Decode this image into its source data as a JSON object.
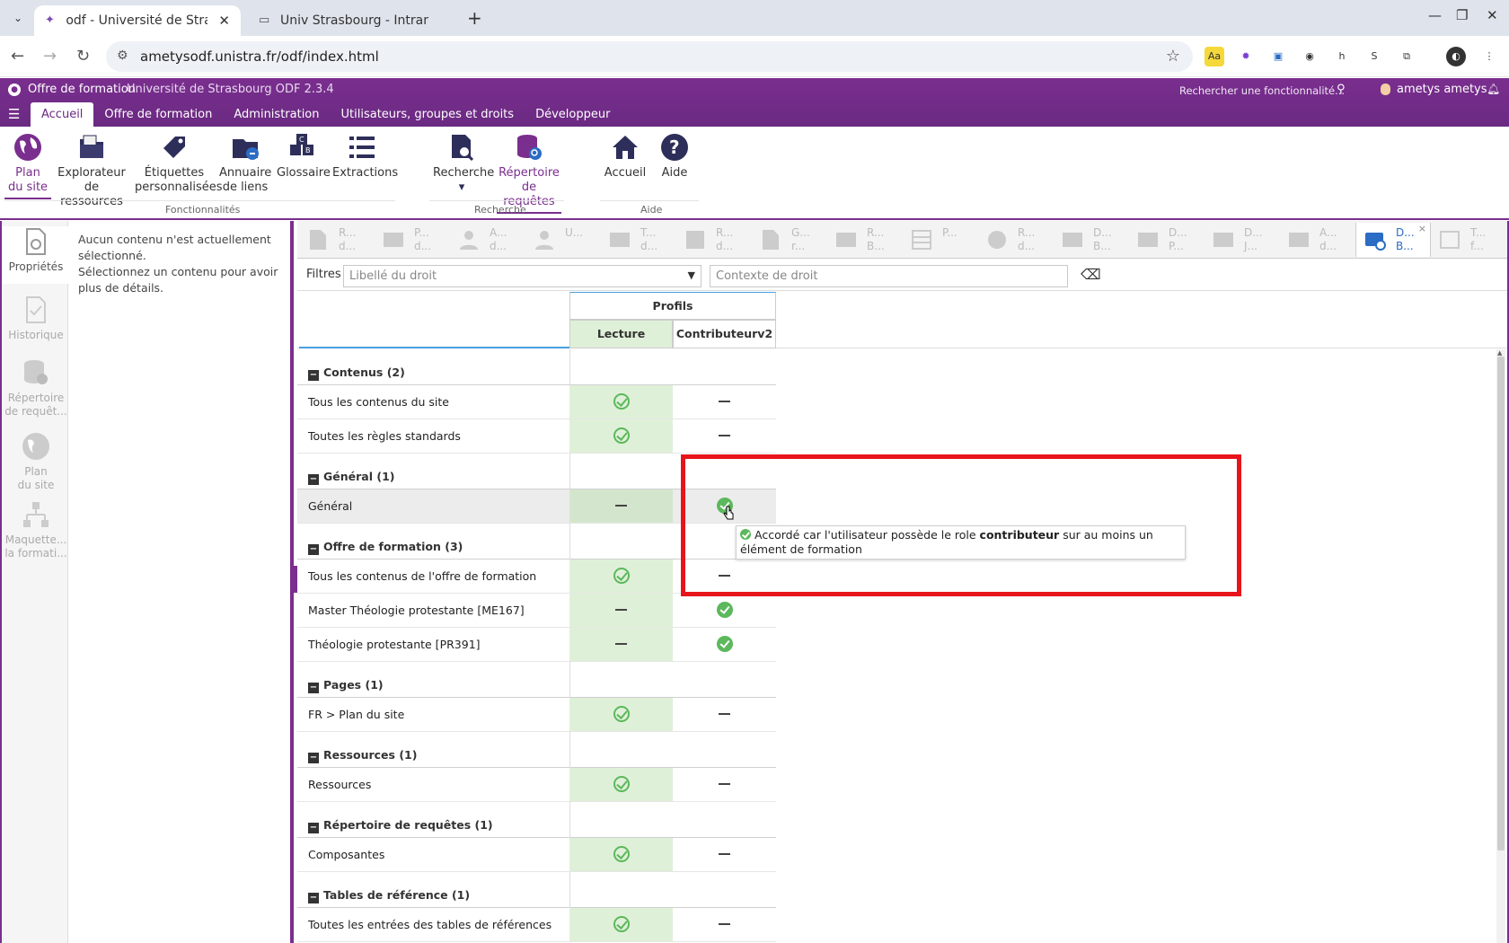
{
  "browser": {
    "tabs": [
      {
        "title": "odf - Université de Strasbourg",
        "active": true
      },
      {
        "title": "Univ Strasbourg - Intranet",
        "active": false
      }
    ],
    "url": "ametysodf.unistra.fr/odf/index.html"
  },
  "app": {
    "title": "Offre de formation",
    "subtitle": "Université de Strasbourg ODF 2.3.4",
    "search_placeholder": "Rechercher une fonctionnalité...",
    "user": "ametys ametys",
    "menu_tabs": [
      "Accueil",
      "Offre de formation",
      "Administration",
      "Utilisateurs, groupes et droits",
      "Développeur"
    ]
  },
  "ribbon": {
    "groups": {
      "fonctionnalites": "Fonctionnalités",
      "recherche": "Recherche",
      "aide": "Aide"
    },
    "buttons": {
      "plan": {
        "l1": "Plan",
        "l2": "du site"
      },
      "explorateur": {
        "l1": "Explorateur",
        "l2": "de ressources"
      },
      "etiquettes": {
        "l1": "Étiquettes",
        "l2": "personnalisées"
      },
      "annuaire": {
        "l1": "Annuaire",
        "l2": "de liens"
      },
      "glossaire": {
        "l1": "Glossaire",
        "l2": ""
      },
      "extractions": {
        "l1": "Extractions",
        "l2": ""
      },
      "recherche": {
        "l1": "Recherche",
        "l2": "▾"
      },
      "repertoire": {
        "l1": "Répertoire",
        "l2": "de requêtes"
      },
      "accueil": {
        "l1": "Accueil",
        "l2": ""
      },
      "aide": {
        "l1": "Aide",
        "l2": ""
      }
    }
  },
  "side_tools": {
    "proprietes": "Propriétés",
    "historique": "Historique",
    "repertoire": {
      "l1": "Répertoire",
      "l2": "de requêt..."
    },
    "plan": {
      "l1": "Plan",
      "l2": "du site"
    },
    "maquette": {
      "l1": "Maquette...",
      "l2": "la formati..."
    }
  },
  "properties_panel": {
    "line1": "Aucun contenu n'est actuellement sélectionné.",
    "line2": "Sélectionnez un contenu pour avoir plus de détails."
  },
  "doc_tabs": [
    {
      "l1": "R...",
      "l2": "d..."
    },
    {
      "l1": "P...",
      "l2": "d..."
    },
    {
      "l1": "A...",
      "l2": "d..."
    },
    {
      "l1": "U...",
      "l2": ""
    },
    {
      "l1": "T...",
      "l2": "d..."
    },
    {
      "l1": "R...",
      "l2": "d..."
    },
    {
      "l1": "G...",
      "l2": "r..."
    },
    {
      "l1": "R...",
      "l2": "B..."
    },
    {
      "l1": "P...",
      "l2": ""
    },
    {
      "l1": "R...",
      "l2": "d..."
    },
    {
      "l1": "D...",
      "l2": "B..."
    },
    {
      "l1": "D...",
      "l2": "P..."
    },
    {
      "l1": "D...",
      "l2": "J..."
    },
    {
      "l1": "A...",
      "l2": "d..."
    },
    {
      "l1": "D...",
      "l2": "B..."
    },
    {
      "l1": "T...",
      "l2": "f..."
    }
  ],
  "filters": {
    "label": "Filtres",
    "right_label_placeholder": "Libellé du droit",
    "context_placeholder": "Contexte de droit"
  },
  "grid": {
    "profiles_header": "Profils",
    "columns": [
      "Lecture",
      "Contributeurv2"
    ],
    "groups": [
      {
        "name": "Contenus (2)",
        "rows": [
          {
            "label": "Tous les contenus du site",
            "lecture": "ok",
            "contrib": "none"
          },
          {
            "label": "Toutes les règles standards",
            "lecture": "ok",
            "contrib": "none"
          }
        ]
      },
      {
        "name": "Général (1)",
        "rows": [
          {
            "label": "Général",
            "lecture": "none",
            "contrib": "ok-filled"
          }
        ]
      },
      {
        "name": "Offre de formation (3)",
        "rows": [
          {
            "label": "Tous les contenus de l'offre de formation",
            "lecture": "ok",
            "contrib": "none"
          },
          {
            "label": "Master Théologie protestante [ME167]",
            "lecture": "none",
            "contrib": "ok-filled"
          },
          {
            "label": "Théologie protestante [PR391]",
            "lecture": "none",
            "contrib": "ok-filled"
          }
        ]
      },
      {
        "name": "Pages (1)",
        "rows": [
          {
            "label": "FR > Plan du site",
            "lecture": "ok",
            "contrib": "none"
          }
        ]
      },
      {
        "name": "Ressources (1)",
        "rows": [
          {
            "label": "Ressources",
            "lecture": "ok",
            "contrib": "none"
          }
        ]
      },
      {
        "name": "Répertoire de requêtes (1)",
        "rows": [
          {
            "label": "Composantes",
            "lecture": "ok",
            "contrib": "none"
          }
        ]
      },
      {
        "name": "Tables de référence (1)",
        "rows": [
          {
            "label": "Toutes les entrées des tables de références",
            "lecture": "ok",
            "contrib": "none"
          }
        ]
      }
    ]
  },
  "tooltip": {
    "before": "Accordé car l'utilisateur possède le role ",
    "bold": "contributeur",
    "after": " sur au moins un élément de formation"
  },
  "colors": {
    "brand": "#7a2e8e",
    "highlight": "#e8141b",
    "granted": "#5cb85c",
    "lecture_bg": "#dff0d8"
  }
}
